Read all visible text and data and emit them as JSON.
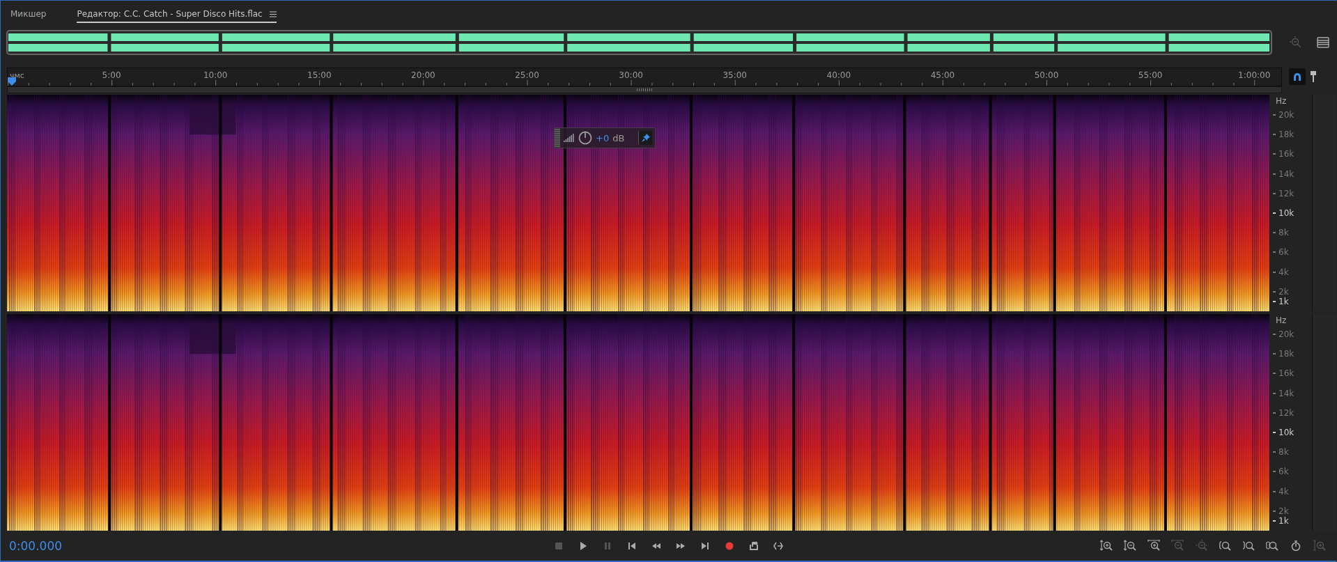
{
  "tabs": [
    {
      "label": "Микшер",
      "selected": false,
      "menu": false
    },
    {
      "label": "Редактор: C.C. Catch - Super Disco Hits.flac",
      "selected": true,
      "menu": true
    }
  ],
  "overview_buttons": [
    {
      "kind": "zoom-out-full",
      "disabled": true
    },
    {
      "kind": "panel-menu",
      "disabled": false
    }
  ],
  "ruler": {
    "unit": "чмс",
    "labels": [
      "5:00",
      "10:00",
      "15:00",
      "20:00",
      "25:00",
      "30:00",
      "35:00",
      "40:00",
      "45:00",
      "50:00",
      "55:00",
      "1:00:00"
    ],
    "snap_on": true
  },
  "channels": [
    {
      "unit": "Hz",
      "freq_labels": [
        {
          "label": "20k",
          "major": false
        },
        {
          "label": "18k",
          "major": false
        },
        {
          "label": "16k",
          "major": false
        },
        {
          "label": "14k",
          "major": false
        },
        {
          "label": "12k",
          "major": false
        },
        {
          "label": "10k",
          "major": true
        },
        {
          "label": "8k",
          "major": false
        },
        {
          "label": "6k",
          "major": false
        },
        {
          "label": "4k",
          "major": false
        },
        {
          "label": "2k",
          "major": false
        },
        {
          "label": "1k",
          "major": true
        }
      ]
    },
    {
      "unit": "Hz",
      "freq_labels": [
        {
          "label": "20k",
          "major": false
        },
        {
          "label": "18k",
          "major": false
        },
        {
          "label": "16k",
          "major": false
        },
        {
          "label": "14k",
          "major": false
        },
        {
          "label": "12k",
          "major": false
        },
        {
          "label": "10k",
          "major": true
        },
        {
          "label": "8k",
          "major": false
        },
        {
          "label": "6k",
          "major": false
        },
        {
          "label": "4k",
          "major": false
        },
        {
          "label": "2k",
          "major": false
        },
        {
          "label": "1k",
          "major": true
        }
      ]
    }
  ],
  "volume_hud": {
    "gain": "+0",
    "unit": "dB",
    "pinned": true
  },
  "time": "0:00.000",
  "transport": [
    {
      "kind": "stop",
      "disabled": true
    },
    {
      "kind": "play",
      "disabled": false
    },
    {
      "kind": "pause",
      "disabled": true
    },
    {
      "kind": "go-to-start",
      "disabled": false
    },
    {
      "kind": "rewind",
      "disabled": false
    },
    {
      "kind": "fast-forward",
      "disabled": false
    },
    {
      "kind": "go-to-end",
      "disabled": false
    },
    {
      "kind": "record",
      "disabled": false
    },
    {
      "kind": "loop",
      "disabled": false
    },
    {
      "kind": "skip-selection",
      "disabled": false
    }
  ],
  "zoom_controls": [
    {
      "kind": "zoom-in-amplitude",
      "disabled": false
    },
    {
      "kind": "zoom-out-amplitude",
      "disabled": false
    },
    {
      "kind": "zoom-in-time",
      "disabled": false
    },
    {
      "kind": "zoom-out-full",
      "disabled": true
    },
    {
      "kind": "zoom-selection",
      "disabled": true
    },
    {
      "kind": "zoom-in-left",
      "disabled": false
    },
    {
      "kind": "zoom-in-right",
      "disabled": false
    },
    {
      "kind": "zoom-both-edges",
      "disabled": false
    },
    {
      "kind": "zoom-to-time",
      "disabled": false
    },
    {
      "kind": "zoom-in-frequency",
      "disabled": true
    }
  ]
}
